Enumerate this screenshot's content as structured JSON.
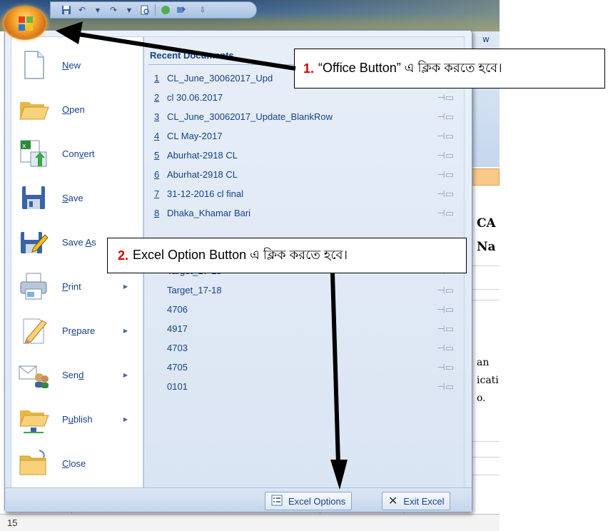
{
  "background": {
    "ribbon_letter": "w",
    "cell_texts": [
      "CA",
      "Na",
      "an",
      "icati",
      "o."
    ],
    "row_number": "15"
  },
  "menu_items": [
    {
      "label": "New",
      "mnemonic": "N",
      "has_arrow": false,
      "icon": "new-document-icon"
    },
    {
      "label": "Open",
      "mnemonic": "O",
      "has_arrow": false,
      "icon": "open-folder-icon"
    },
    {
      "label": "Convert",
      "mnemonic": "v",
      "has_arrow": false,
      "icon": "convert-icon"
    },
    {
      "label": "Save",
      "mnemonic": "S",
      "has_arrow": false,
      "icon": "save-disk-icon"
    },
    {
      "label": "Save As",
      "mnemonic": "A",
      "has_arrow": true,
      "icon": "save-as-icon"
    },
    {
      "label": "Print",
      "mnemonic": "P",
      "has_arrow": true,
      "icon": "printer-icon"
    },
    {
      "label": "Prepare",
      "mnemonic": "e",
      "has_arrow": true,
      "icon": "prepare-icon"
    },
    {
      "label": "Send",
      "mnemonic": "d",
      "has_arrow": true,
      "icon": "send-icon"
    },
    {
      "label": "Publish",
      "mnemonic": "u",
      "has_arrow": true,
      "icon": "publish-icon"
    },
    {
      "label": "Close",
      "mnemonic": "C",
      "has_arrow": false,
      "icon": "close-folder-icon"
    }
  ],
  "recent": {
    "title": "Recent Documents",
    "documents": [
      {
        "num": "1",
        "name": "CL_June_30062017_Upd"
      },
      {
        "num": "2",
        "name": "cl 30.06.2017"
      },
      {
        "num": "3",
        "name": "CL_June_30062017_Update_BlankRow"
      },
      {
        "num": "4",
        "name": "CL May-2017"
      },
      {
        "num": "5",
        "name": "Aburhat-2918 CL"
      },
      {
        "num": "6",
        "name": "Aburhat-2918 CL"
      },
      {
        "num": "7",
        "name": "31-12-2016 cl final"
      },
      {
        "num": "8",
        "name": "Dhaka_Khamar Bari"
      },
      {
        "num": "",
        "name": ""
      },
      {
        "num": "",
        "name": ""
      },
      {
        "num": "",
        "name": "Target_17-18"
      },
      {
        "num": "",
        "name": "Target_17-18"
      },
      {
        "num": "",
        "name": "4706"
      },
      {
        "num": "",
        "name": "4917"
      },
      {
        "num": "",
        "name": "4703"
      },
      {
        "num": "",
        "name": "4705"
      },
      {
        "num": "",
        "name": "0101"
      }
    ]
  },
  "buttons": {
    "excel_options": "Excel Options",
    "exit_excel": "Exit Excel"
  },
  "callouts": {
    "one_num": "1.",
    "one_text": "“Office Button” এ ক্লিক করতে হবে।",
    "two_num": "2.",
    "two_text": "Excel Option Button এ ক্লিক করতে হবে।"
  },
  "colors": {
    "menu_text": "#15428b",
    "callout_number": "#d40000",
    "arrow": "#000000"
  }
}
